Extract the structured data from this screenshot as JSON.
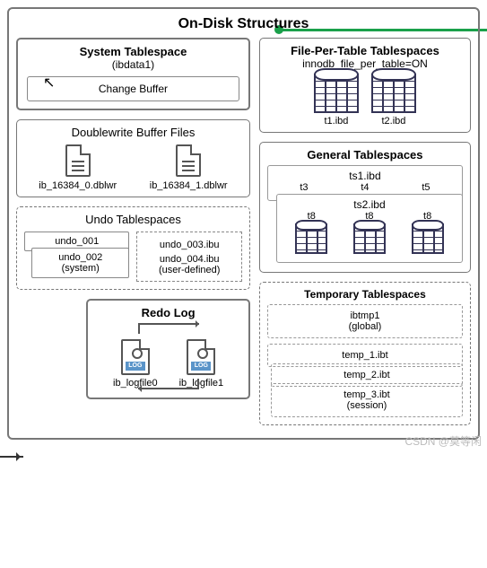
{
  "title": "On-Disk Structures",
  "system_tablespace": {
    "title": "System Tablespace",
    "subtitle": "(ibdata1)",
    "change_buffer": "Change Buffer"
  },
  "doublewrite": {
    "title": "Doublewrite Buffer Files",
    "files": [
      "ib_16384_0.dblwr",
      "ib_16384_1.dblwr"
    ]
  },
  "undo": {
    "title": "Undo Tablespaces",
    "system": {
      "items": [
        "undo_001",
        "undo_002"
      ],
      "label": "(system)"
    },
    "user": {
      "items": [
        "undo_003.ibu",
        "undo_004.ibu"
      ],
      "label": "(user-defined)"
    }
  },
  "redo": {
    "title": "Redo Log",
    "log_badge": "LOG",
    "files": [
      "ib_logfile0",
      "ib_logfile1"
    ]
  },
  "fpt": {
    "title": "File-Per-Table Tablespaces",
    "setting": "innodb_file_per_table=ON",
    "files": [
      "t1.ibd",
      "t2.ibd"
    ]
  },
  "general": {
    "title": "General Tablespaces",
    "groups": [
      {
        "name": "ts1.ibd",
        "cols": [
          "t3",
          "t4",
          "t5"
        ]
      },
      {
        "name": "ts2.ibd",
        "cols": [
          "t8",
          "t8",
          "t8"
        ]
      }
    ]
  },
  "temp": {
    "title": "Temporary Tablespaces",
    "global": {
      "name": "ibtmp1",
      "label": "(global)"
    },
    "session": {
      "files": [
        "temp_1.ibt",
        "temp_2.ibt",
        "temp_3.ibt"
      ],
      "label": "(session)"
    }
  },
  "watermark": "CSDN @莫等闲"
}
